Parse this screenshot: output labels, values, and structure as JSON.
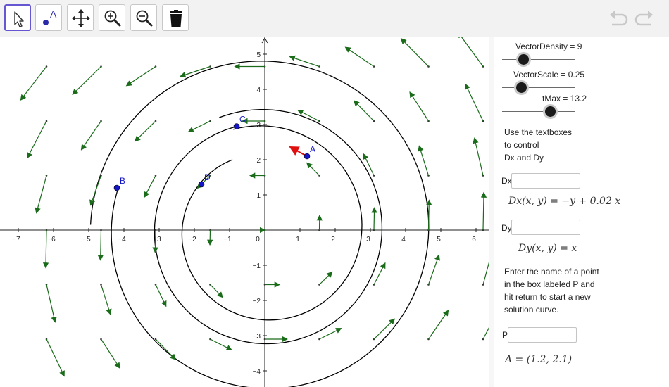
{
  "toolbar": {
    "tools": [
      {
        "name": "move-tool",
        "icon": "cursor-arrow-icon",
        "active": true
      },
      {
        "name": "point-tool",
        "icon": "point-icon",
        "label": "A"
      },
      {
        "name": "move-graphics-view-tool",
        "icon": "move-cross-icon"
      },
      {
        "name": "zoom-in-tool",
        "icon": "zoom-in-icon"
      },
      {
        "name": "zoom-out-tool",
        "icon": "zoom-out-icon"
      },
      {
        "name": "delete-tool",
        "icon": "trash-icon"
      }
    ],
    "undo_icon": "undo-icon",
    "redo_icon": "redo-icon"
  },
  "graphics": {
    "x_ticks": [
      "−7",
      "−6",
      "−5",
      "−4",
      "−3",
      "−2",
      "−1",
      "0",
      "1",
      "2",
      "3",
      "4",
      "5",
      "6"
    ],
    "y_ticks": [
      "5",
      "4",
      "3",
      "2",
      "1",
      "−1",
      "−2",
      "−3",
      "−4"
    ],
    "points": [
      {
        "label": "A",
        "x": 1.2,
        "y": 2.1
      },
      {
        "label": "B",
        "x": -4.2,
        "y": 1.2
      },
      {
        "label": "C",
        "x": -0.8,
        "y": 2.95
      },
      {
        "label": "D",
        "x": -1.8,
        "y": 1.3
      }
    ],
    "colors": {
      "field": "#1a6b1a",
      "solution": "#000000",
      "point": "#1515c8",
      "point_vector": "#e01010"
    }
  },
  "panel": {
    "sliders": [
      {
        "label": "VectorDensity = 9",
        "value": 9,
        "min": 5,
        "max": 15
      },
      {
        "label": "VectorScale = 0.25",
        "value": 0.25,
        "min": 0.2,
        "max": 1
      },
      {
        "label": "tMax = 13.2",
        "value": 13.2,
        "min": 0,
        "max": 20
      }
    ],
    "instructions1": [
      "Use the textboxes",
      "to control",
      "Dx and Dy"
    ],
    "dx_label": "Dx",
    "dx_value": "",
    "dx_formula": "Dx(x, y) = −y + 0.02 x",
    "dy_label": "Dy",
    "dy_value": "",
    "dy_formula": "Dy(x, y) = x",
    "instructions2": [
      "Enter the name of a point",
      "in the box labeled P and",
      "hit return to start a new",
      "solution curve."
    ],
    "p_label": "P",
    "p_value": "",
    "result": "A = (1.2, 2.1)"
  }
}
